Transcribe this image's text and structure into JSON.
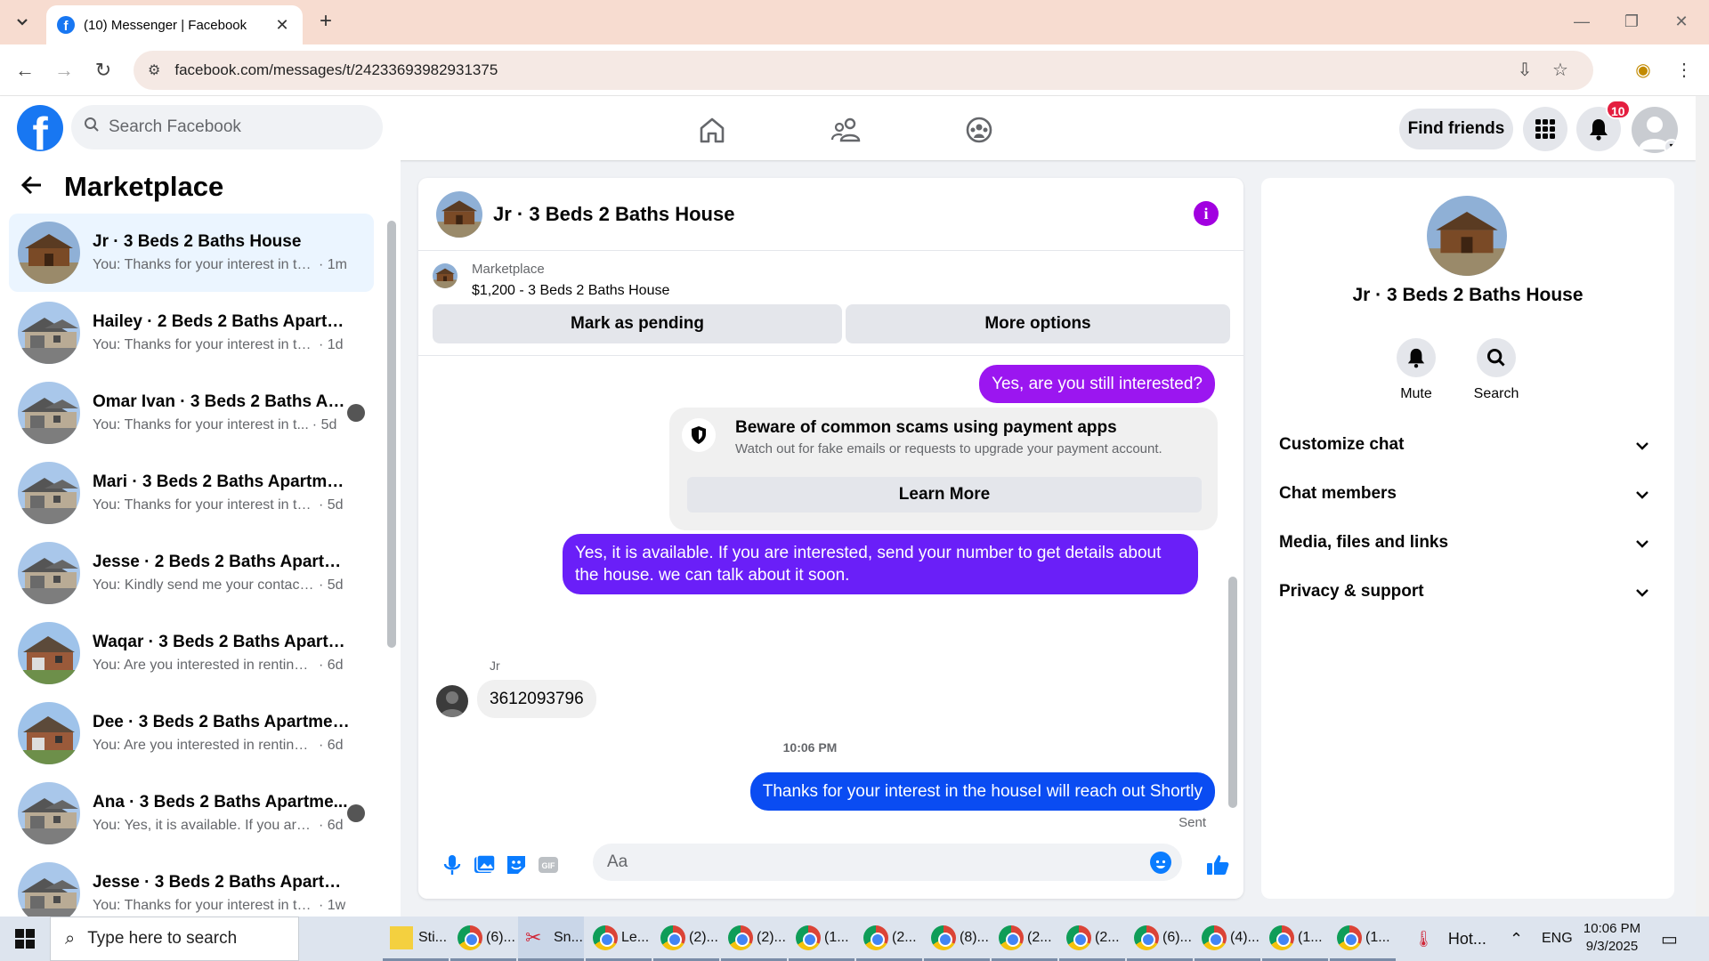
{
  "browser": {
    "tab_title": "(10) Messenger | Facebook",
    "url": "facebook.com/messages/t/24233693982931375"
  },
  "fb_header": {
    "search_placeholder": "Search Facebook",
    "find_friends_label": "Find friends",
    "notification_count": "10"
  },
  "left_panel": {
    "title": "Marketplace",
    "conversations": [
      {
        "name": "Jr · 3 Beds 2 Baths House",
        "preview": "You: Thanks for your interest in the house...",
        "time": "· 1m",
        "active": true
      },
      {
        "name": "Hailey · 2 Beds 2 Baths Apartme...",
        "preview": "You: Thanks for your interest in the ...",
        "time": "· 1d"
      },
      {
        "name": "Omar Ivan · 3 Beds 2 Baths Ap...",
        "preview": "You: Thanks for your interest in t...",
        "time": "· 5d"
      },
      {
        "name": "Mari · 3 Beds 2 Baths Apartment...",
        "preview": "You: Thanks for your interest in the ...",
        "time": "· 5d"
      },
      {
        "name": "Jesse · 2 Beds 2 Baths Apartmen...",
        "preview": "You: Kindly send me your contact n...",
        "time": "· 5d"
      },
      {
        "name": "Waqar · 3 Beds 2 Baths Apartme...",
        "preview": "You: Are you interested in renting t...",
        "time": "· 6d"
      },
      {
        "name": "Dee · 3 Beds 2 Baths Apartment...",
        "preview": "You: Are you interested in renting t...",
        "time": "· 6d"
      },
      {
        "name": "Ana · 3 Beds 2 Baths Apartme...",
        "preview": "You: Yes, it is available. If you are...",
        "time": "· 6d"
      },
      {
        "name": "Jesse · 3 Beds 2 Baths Apartmen...",
        "preview": "You: Thanks for your interest in the...",
        "time": "· 1w"
      }
    ]
  },
  "chat": {
    "title": "Jr · 3 Beds 2 Baths House",
    "marketplace_label": "Marketplace",
    "listing": "$1,200 - 3 Beds 2 Baths House",
    "mark_pending_label": "Mark as pending",
    "more_options_label": "More options",
    "messages": {
      "m1": "Yes, are you still interested?",
      "m2": "Yes, it is available. If you are interested, send your number to get details about the house. we can talk about it soon.",
      "m3": "3612093796",
      "m4": "Thanks for your interest in the houseI will reach out Shortly"
    },
    "scam_notice": {
      "heading": "Beware of common scams using payment apps",
      "body": "Watch out for fake emails or requests to upgrade your payment account.",
      "button": "Learn More"
    },
    "sender_name": "Jr",
    "timestamp": "10:06 PM",
    "sent_status": "Sent",
    "composer_placeholder": "Aa"
  },
  "right_panel": {
    "name": "Jr · 3 Beds 2 Baths House",
    "mute_label": "Mute",
    "search_label": "Search",
    "sections": [
      "Customize chat",
      "Chat members",
      "Media, files and links",
      "Privacy & support"
    ]
  },
  "taskbar": {
    "search_placeholder": "Type here to search",
    "apps": [
      "Sti...",
      "(6)...",
      "Sn...",
      "Le...",
      "(2)...",
      "(2)...",
      "(1...",
      "(2...",
      "(8)...",
      "(2...",
      "(2...",
      "(6)...",
      "(4)...",
      "(1...",
      "(1..."
    ],
    "weather": "Hot...",
    "lang": "ENG",
    "time": "10:06 PM",
    "date": "9/3/2025"
  },
  "colors": {
    "facebook_blue": "#1877f2",
    "bubble_purple": "#9b16f0",
    "bubble_indigo": "#6a1ff8",
    "bubble_blue": "#0a4cf2",
    "info_purple": "#a100e0",
    "badge_red": "#e41e3f"
  }
}
